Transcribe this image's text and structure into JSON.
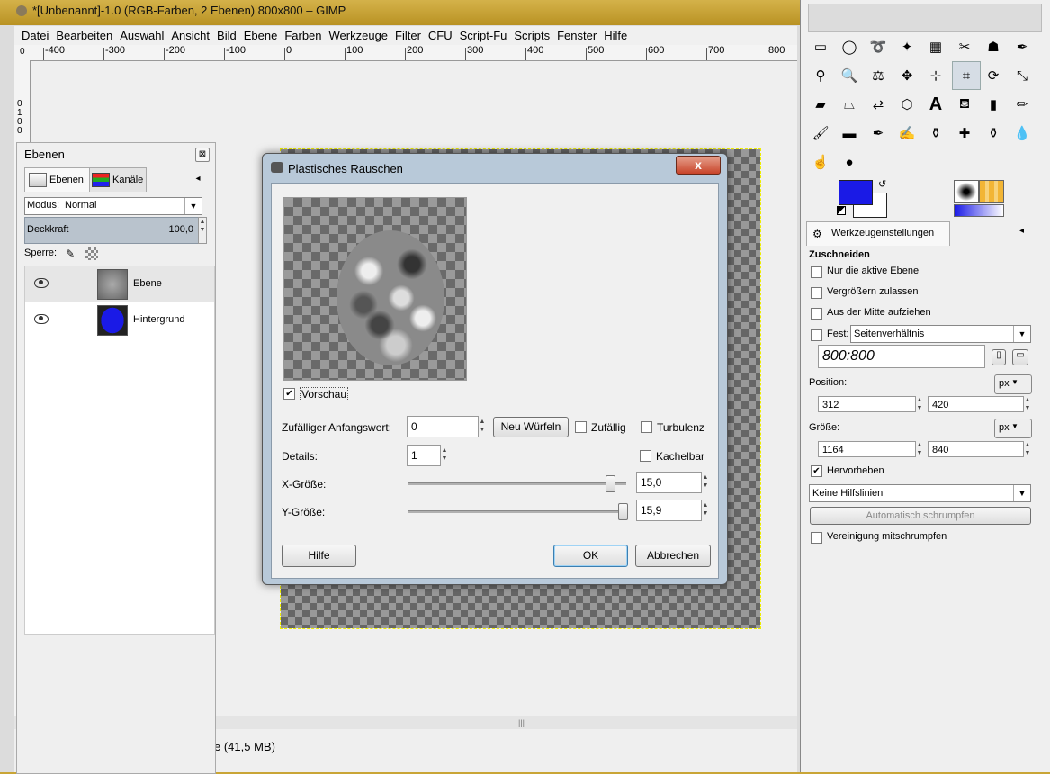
{
  "window": {
    "title": "*[Unbenannt]-1.0 (RGB-Farben, 2 Ebenen) 800x800 – GIMP"
  },
  "menu": [
    "Datei",
    "Bearbeiten",
    "Auswahl",
    "Ansicht",
    "Bild",
    "Ebene",
    "Farben",
    "Werkzeuge",
    "Filter",
    "CFU",
    "Script-Fu",
    "Scripts",
    "Fenster",
    "Hilfe"
  ],
  "ruler": {
    "ticks": [
      "-400",
      "-300",
      "-200",
      "-100",
      "0",
      "100",
      "200",
      "300",
      "400",
      "500",
      "600",
      "700",
      "800"
    ],
    "vertical": "0 100",
    "corner": "0"
  },
  "statusbar": {
    "text": "e (41,5 MB)"
  },
  "layers_dock": {
    "title": "Ebenen",
    "tab_layers": "Ebenen",
    "tab_channels": "Kanäle",
    "mode_label": "Modus:",
    "mode_value": "Normal",
    "opacity_label": "Deckkraft",
    "opacity_value": "100,0",
    "lock_label": "Sperre:",
    "layers": [
      {
        "name": "Ebene"
      },
      {
        "name": "Hintergrund"
      }
    ]
  },
  "dialog": {
    "title": "Plastisches Rauschen",
    "preview_label": "Vorschau",
    "preview_checked": true,
    "seed_label": "Zufälliger Anfangswert:",
    "seed_value": "0",
    "new_seed_button": "Neu Würfeln",
    "random_label": "Zufällig",
    "turbulence_label": "Turbulenz",
    "details_label": "Details:",
    "details_value": "1",
    "tileable_label": "Kachelbar",
    "xsize_label": "X-Größe:",
    "xsize_value": "15,0",
    "ysize_label": "Y-Größe:",
    "ysize_value": "15,9",
    "help_button": "Hilfe",
    "ok_button": "OK",
    "cancel_button": "Abbrechen",
    "close_glyph": "x"
  },
  "tool_options": {
    "tab_label": "Werkzeugeinstellungen",
    "tool_name": "Zuschneiden",
    "only_active_layer": "Nur die aktive Ebene",
    "allow_growing": "Vergrößern zulassen",
    "expand_from_center": "Aus der Mitte aufziehen",
    "fixed_label": "Fest:",
    "fixed_value": "Seitenverhältnis",
    "ratio_value": "800:800",
    "position_label": "Position:",
    "position_unit": "px",
    "pos_x": "312",
    "pos_y": "420",
    "size_label": "Größe:",
    "size_unit": "px",
    "size_w": "1164",
    "size_h": "840",
    "highlight_label": "Hervorheben",
    "guides_value": "Keine Hilfslinien",
    "auto_shrink_button": "Automatisch schrumpfen",
    "shrink_merged_label": "Vereinigung mitschrumpfen"
  },
  "colors": {
    "foreground": "#1a1ae6",
    "background": "#ffffff"
  }
}
